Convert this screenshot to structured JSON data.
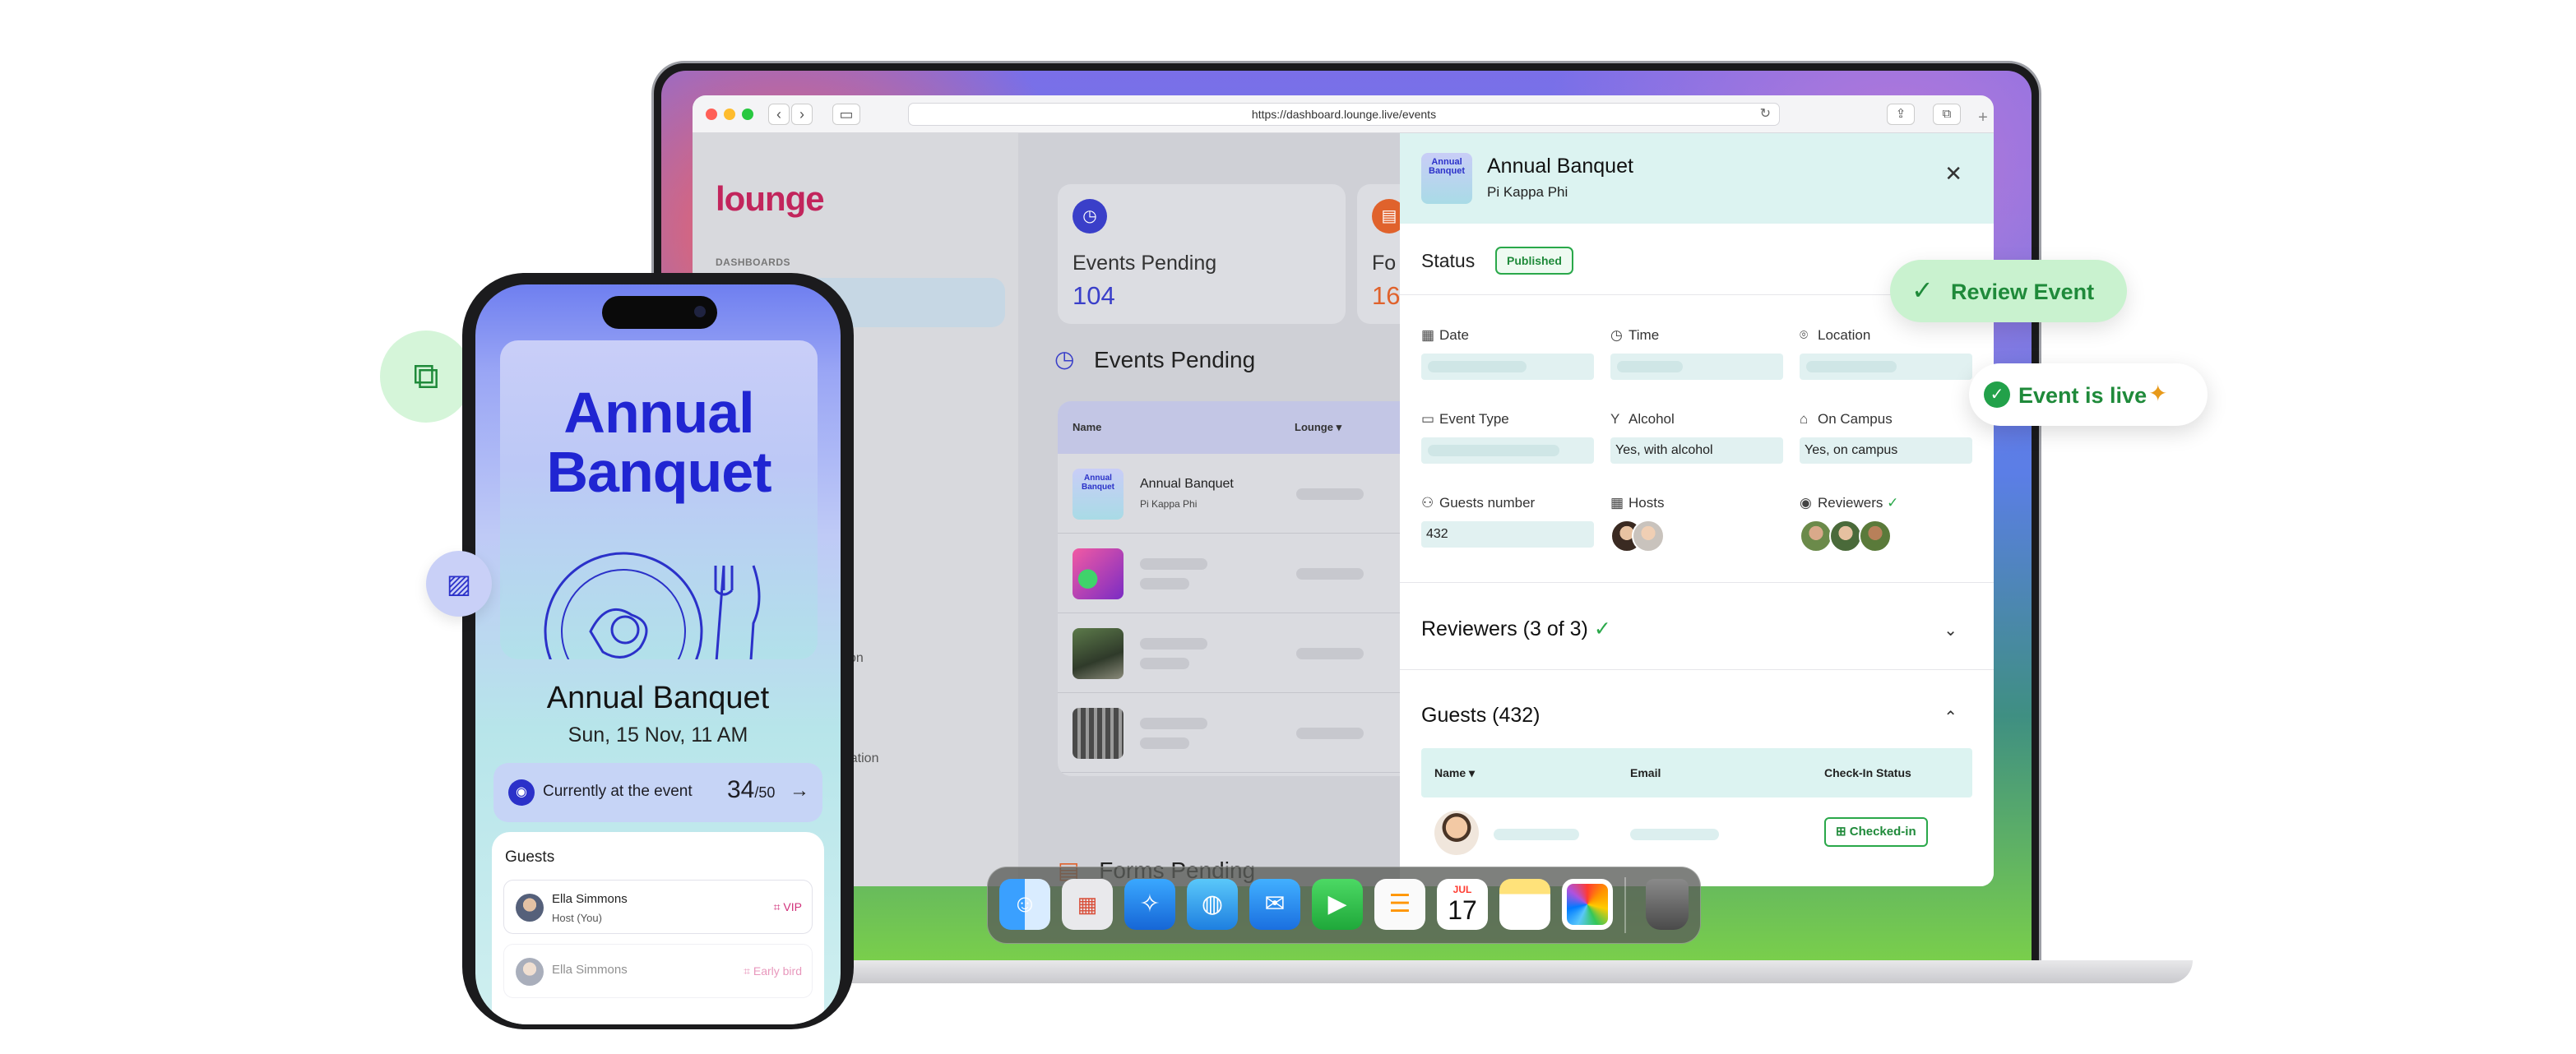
{
  "browser": {
    "url": "https://dashboard.lounge.live/events",
    "back_icon": "‹",
    "forward_icon": "›"
  },
  "dashboard": {
    "logo": "lounge",
    "section_label": "DASHBOARDS",
    "sidebar_fragments": [
      "tion",
      "tration"
    ],
    "stats": [
      {
        "label": "Events Pending",
        "value": "104"
      },
      {
        "label": "Fo",
        "value": "16"
      }
    ],
    "events_pending_title": "Events Pending",
    "table": {
      "col_name": "Name",
      "col_lounge": "Lounge",
      "first_row_title": "Annual Banquet",
      "first_row_org": "Pi Kappa Phi"
    },
    "forms_pending_title": "Forms Pending"
  },
  "panel": {
    "thumb_text": "Annual Banquet",
    "title": "Annual Banquet",
    "org": "Pi Kappa Phi",
    "close_icon": "✕",
    "status_label": "Status",
    "status_value": "Published",
    "fields": {
      "date": "Date",
      "time": "Time",
      "location": "Location",
      "event_type": "Event Type",
      "alcohol": "Alcohol",
      "alcohol_value": "Yes, with alcohol",
      "on_campus": "On Campus",
      "on_campus_value": "Yes, on campus",
      "guests_number": "Guests number",
      "guests_number_value": "432",
      "hosts": "Hosts",
      "reviewers": "Reviewers"
    },
    "reviewers_summary": "Reviewers (3 of 3)",
    "guests_summary": "Guests (432)",
    "guest_table": {
      "col_name": "Name",
      "col_email": "Email",
      "col_checkin": "Check-In Status",
      "row_status": "Checked-in"
    }
  },
  "pills": {
    "review_event": "Review Event",
    "event_live": "Event is live"
  },
  "dock": {
    "calendar_month": "JUL",
    "calendar_day": "17"
  },
  "phone": {
    "poster_title_line1": "Annual",
    "poster_title_line2": "Banquet",
    "title": "Annual Banquet",
    "date": "Sun, 15 Nov, 11 AM",
    "currently_label": "Currently at the event",
    "current_count": "34",
    "current_max": "/50",
    "guests_title": "Guests",
    "guests": [
      {
        "name": "Ella Simmons",
        "role": "Host (You)",
        "badge": "VIP"
      },
      {
        "name": "Ella Simmons",
        "role": "",
        "badge": "Early bird"
      }
    ]
  }
}
